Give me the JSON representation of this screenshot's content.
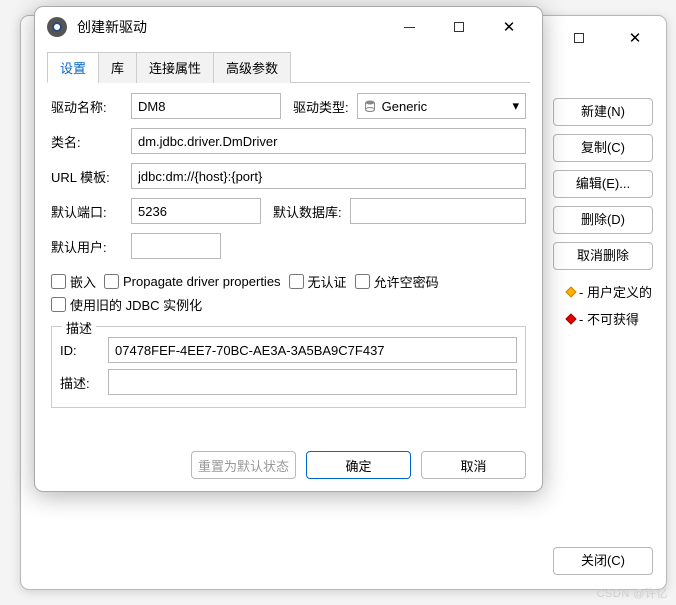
{
  "bg": {
    "side": {
      "new": "新建(N)",
      "copy": "复制(C)",
      "edit": "编辑(E)...",
      "del": "删除(D)",
      "undo_del": "取消删除"
    },
    "legend": {
      "user": "- 用户定义的",
      "unavail": "- 不可获得"
    },
    "close": "关闭(C)"
  },
  "dlg": {
    "title": "创建新驱动",
    "tabs": {
      "settings": "设置",
      "lib": "库",
      "conn": "连接属性",
      "adv": "高级参数"
    },
    "fields": {
      "name_lbl": "驱动名称:",
      "name_val": "DM8",
      "type_lbl": "驱动类型:",
      "type_val": "Generic",
      "class_lbl": "类名:",
      "class_val": "dm.jdbc.driver.DmDriver",
      "url_lbl": "URL 模板:",
      "url_val": "jdbc:dm://{host}:{port}",
      "port_lbl": "默认端口:",
      "port_val": "5236",
      "db_lbl": "默认数据库:",
      "db_val": "",
      "user_lbl": "默认用户:",
      "user_val": ""
    },
    "chk": {
      "embed": "嵌入",
      "propagate": "Propagate driver properties",
      "noauth": "无认证",
      "empty_pw": "允许空密码",
      "old_jdbc": "使用旧的 JDBC 实例化"
    },
    "desc": {
      "group": "描述",
      "id_lbl": "ID:",
      "id_val": "07478FEF-4EE7-70BC-AE3A-3A5BA9C7F437",
      "desc_lbl": "描述:",
      "desc_val": ""
    },
    "buttons": {
      "reset": "重置为默认状态",
      "ok": "确定",
      "cancel": "取消"
    }
  },
  "watermark": "CSDN @许忆"
}
